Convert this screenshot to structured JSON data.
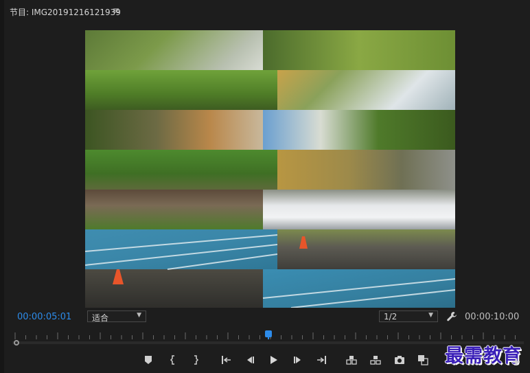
{
  "panel": {
    "title": "节目: IMG20191216121939",
    "menu_icon": "hamburger-menu-icon"
  },
  "timecode": {
    "current": "00:00:05:01",
    "duration": "00:00:10:00"
  },
  "zoom_select": {
    "value": "适合"
  },
  "resolution_select": {
    "value": "1/2"
  },
  "colors": {
    "accent": "#2d8ceb",
    "background": "#1d1d1d"
  },
  "playhead": {
    "position_fraction": 0.5
  },
  "controls": [
    {
      "name": "add-marker-button",
      "icon": "marker-icon"
    },
    {
      "name": "mark-in-button",
      "icon": "mark-in-icon"
    },
    {
      "name": "mark-out-button",
      "icon": "mark-out-icon"
    },
    {
      "name": "go-to-in-button",
      "icon": "go-to-in-icon"
    },
    {
      "name": "step-back-button",
      "icon": "step-back-icon"
    },
    {
      "name": "play-button",
      "icon": "play-icon"
    },
    {
      "name": "step-forward-button",
      "icon": "step-forward-icon"
    },
    {
      "name": "go-to-out-button",
      "icon": "go-to-out-icon"
    },
    {
      "name": "lift-button",
      "icon": "lift-icon"
    },
    {
      "name": "extract-button",
      "icon": "extract-icon"
    },
    {
      "name": "export-frame-button",
      "icon": "camera-icon"
    },
    {
      "name": "compare-view-button",
      "icon": "compare-icon"
    }
  ],
  "watermark": {
    "text": "最需教育"
  }
}
